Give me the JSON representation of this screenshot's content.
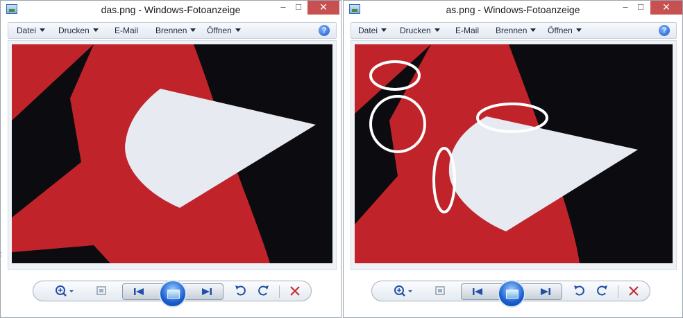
{
  "left_window": {
    "title": "das.png - Windows-Fotoanzeige",
    "menu": [
      "Datei",
      "Drucken",
      "E-Mail",
      "Brennen",
      "Öffnen"
    ],
    "help_label": "?"
  },
  "right_window": {
    "title": "as.png - Windows-Fotoanzeige",
    "menu": [
      "Datei",
      "Drucken",
      "E-Mail",
      "Brennen",
      "Öffnen"
    ],
    "help_label": "?"
  },
  "window_controls": {
    "minimize": "–",
    "maximize": "□",
    "close": "✕"
  },
  "toolbar_icons": [
    "zoom-icon",
    "actual-size-icon",
    "previous-icon",
    "slideshow-icon",
    "next-icon",
    "rotate-left-icon",
    "rotate-right-icon",
    "delete-icon"
  ],
  "image_colors": {
    "red": "#c0242a",
    "black": "#0c0c10",
    "white_shape": "#e8eaf2",
    "annotation": "#ffffff"
  },
  "edge_char": ":"
}
